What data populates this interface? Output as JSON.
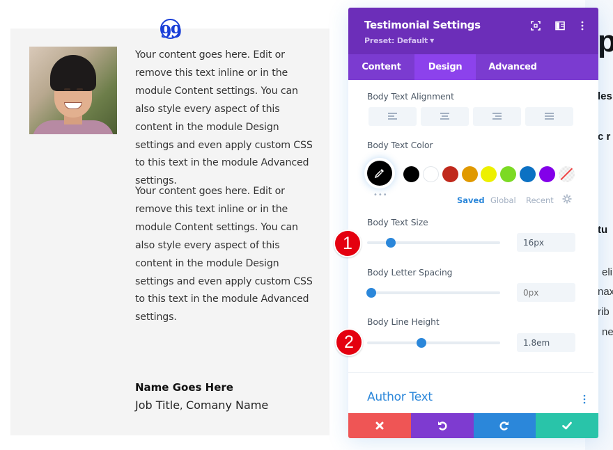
{
  "background_page": {
    "fragments": [
      {
        "text": "p",
        "style": "big"
      },
      {
        "text": "les",
        "style": "h"
      },
      {
        "text": "c r",
        "style": "h"
      },
      {
        "text": "tu",
        "style": "h"
      },
      {
        "text": "eli",
        "style": "p"
      },
      {
        "text": "nax",
        "style": "p"
      },
      {
        "text": "rib",
        "style": "p"
      },
      {
        "text": "ne",
        "style": "p"
      }
    ]
  },
  "testimonial": {
    "quote_icon": "quote-icon",
    "portrait_alt": "Smiling man portrait",
    "body_paragraphs": [
      "Your content goes here. Edit or remove this text inline or in the module Content settings. You can also style every aspect of this content in the module Design settings and even apply custom CSS to this text in the module Advanced settings.",
      "Your content goes here. Edit or remove this text inline or in the module Content settings. You can also style every aspect of this content in the module Design settings and even apply custom CSS to this text in the module Advanced settings."
    ],
    "author_name": "Name Goes Here",
    "job_title": "Job Title",
    "separator": ", ",
    "company": "Comany Name"
  },
  "panel": {
    "title": "Testimonial Settings",
    "preset": "Preset: Default",
    "header_icons": [
      "expand-icon",
      "split-view-icon",
      "more-options-icon"
    ],
    "tabs": [
      {
        "label": "Content",
        "active": false
      },
      {
        "label": "Design",
        "active": true
      },
      {
        "label": "Advanced",
        "active": false
      }
    ],
    "body_text_alignment": {
      "label": "Body Text Alignment",
      "options": [
        "left",
        "center",
        "right",
        "justify"
      ]
    },
    "body_text_color": {
      "label": "Body Text Color",
      "current": "#000000",
      "swatches": [
        "#000000",
        "#ffffff",
        "#c0291c",
        "#e09900",
        "#edf000",
        "#7cda24",
        "#0c71c3",
        "#8300e9",
        "none"
      ],
      "palette_tabs": [
        "Saved",
        "Global",
        "Recent"
      ],
      "active_palette_tab": "Saved"
    },
    "body_text_size": {
      "label": "Body Text Size",
      "value": "16px",
      "slider_fraction": 0.18
    },
    "body_letter_spacing": {
      "label": "Body Letter Spacing",
      "value": "",
      "placeholder": "0px",
      "slider_fraction": 0.03
    },
    "body_line_height": {
      "label": "Body Line Height",
      "value": "1.8em",
      "slider_fraction": 0.41
    },
    "next_section": "Author Text",
    "footer_buttons": [
      {
        "name": "discard",
        "icon": "close-icon",
        "color": "#ef5555"
      },
      {
        "name": "undo",
        "icon": "undo-icon",
        "color": "#7e3bd0"
      },
      {
        "name": "redo",
        "icon": "redo-icon",
        "color": "#2b87da"
      },
      {
        "name": "save",
        "icon": "check-icon",
        "color": "#29c4a9"
      }
    ]
  },
  "annotations": {
    "badge_1": "1",
    "badge_2": "2"
  },
  "colors": {
    "header_purple": "#6c2eb9",
    "tab_bar_purple": "#7b3bd0",
    "active_tab_purple": "#8c42ec",
    "accent_blue": "#2b87da",
    "quote_blue": "#1a3fd8",
    "badge_red": "#e4000f"
  }
}
